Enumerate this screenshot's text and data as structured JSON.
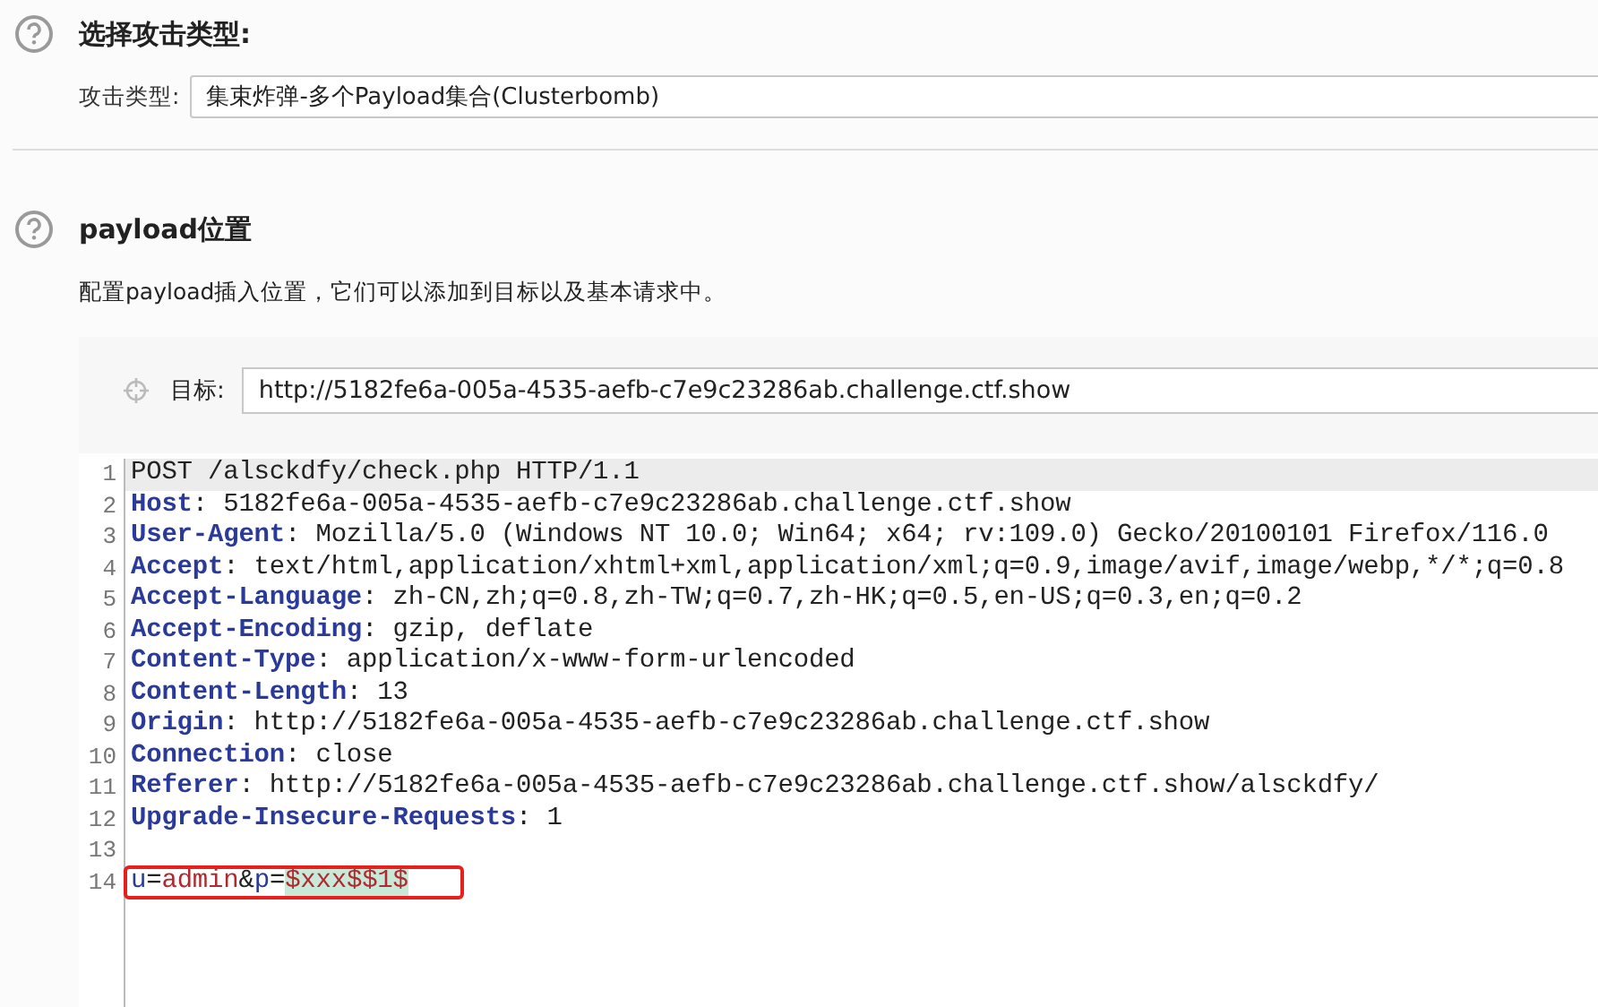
{
  "attack_section": {
    "title": "选择攻击类型:",
    "field_label": "攻击类型:",
    "attack_type": "集束炸弹-多个Payload集合(Clusterbomb)"
  },
  "payload_section": {
    "title": "payload位置",
    "description": "配置payload插入位置，它们可以添加到目标以及基本请求中。",
    "target": {
      "label": "目标:",
      "value": "http://5182fe6a-005a-4535-aefb-c7e9c23286ab.challenge.ctf.show"
    },
    "request_lines": [
      {
        "number": "1",
        "highlighted": true,
        "outlined": false,
        "segments": [
          {
            "kind": "text",
            "text": "POST /alsckdfy/check.php HTTP/1.1"
          }
        ]
      },
      {
        "number": "2",
        "highlighted": false,
        "outlined": false,
        "segments": [
          {
            "kind": "header_name",
            "text": "Host"
          },
          {
            "kind": "text",
            "text": ": 5182fe6a-005a-4535-aefb-c7e9c23286ab.challenge.ctf.show"
          }
        ]
      },
      {
        "number": "3",
        "highlighted": false,
        "outlined": false,
        "segments": [
          {
            "kind": "header_name",
            "text": "User-Agent"
          },
          {
            "kind": "text",
            "text": ": Mozilla/5.0 (Windows NT 10.0; Win64; x64; rv:109.0) Gecko/20100101 Firefox/116.0"
          }
        ]
      },
      {
        "number": "4",
        "highlighted": false,
        "outlined": false,
        "segments": [
          {
            "kind": "header_name",
            "text": "Accept"
          },
          {
            "kind": "text",
            "text": ": text/html,application/xhtml+xml,application/xml;q=0.9,image/avif,image/webp,*/*;q=0.8"
          }
        ]
      },
      {
        "number": "5",
        "highlighted": false,
        "outlined": false,
        "segments": [
          {
            "kind": "header_name",
            "text": "Accept-Language"
          },
          {
            "kind": "text",
            "text": ": zh-CN,zh;q=0.8,zh-TW;q=0.7,zh-HK;q=0.5,en-US;q=0.3,en;q=0.2"
          }
        ]
      },
      {
        "number": "6",
        "highlighted": false,
        "outlined": false,
        "segments": [
          {
            "kind": "header_name",
            "text": "Accept-Encoding"
          },
          {
            "kind": "text",
            "text": ": gzip, deflate"
          }
        ]
      },
      {
        "number": "7",
        "highlighted": false,
        "outlined": false,
        "segments": [
          {
            "kind": "header_name",
            "text": "Content-Type"
          },
          {
            "kind": "text",
            "text": ": application/x-www-form-urlencoded"
          }
        ]
      },
      {
        "number": "8",
        "highlighted": false,
        "outlined": false,
        "segments": [
          {
            "kind": "header_name",
            "text": "Content-Length"
          },
          {
            "kind": "text",
            "text": ": 13"
          }
        ]
      },
      {
        "number": "9",
        "highlighted": false,
        "outlined": false,
        "segments": [
          {
            "kind": "header_name",
            "text": "Origin"
          },
          {
            "kind": "text",
            "text": ": http://5182fe6a-005a-4535-aefb-c7e9c23286ab.challenge.ctf.show"
          }
        ]
      },
      {
        "number": "10",
        "highlighted": false,
        "outlined": false,
        "segments": [
          {
            "kind": "header_name",
            "text": "Connection"
          },
          {
            "kind": "text",
            "text": ": close"
          }
        ]
      },
      {
        "number": "11",
        "highlighted": false,
        "outlined": false,
        "segments": [
          {
            "kind": "header_name",
            "text": "Referer"
          },
          {
            "kind": "text",
            "text": ": http://5182fe6a-005a-4535-aefb-c7e9c23286ab.challenge.ctf.show/alsckdfy/"
          }
        ]
      },
      {
        "number": "12",
        "highlighted": false,
        "outlined": false,
        "segments": [
          {
            "kind": "header_name",
            "text": "Upgrade-Insecure-Requests"
          },
          {
            "kind": "text",
            "text": ": 1"
          }
        ]
      },
      {
        "number": "13",
        "highlighted": false,
        "outlined": false
      },
      {
        "number": "14",
        "highlighted": false,
        "outlined": true,
        "segments": [
          {
            "kind": "param_name",
            "text": "u"
          },
          {
            "kind": "text",
            "text": "="
          },
          {
            "kind": "param_value",
            "text": "admin"
          },
          {
            "kind": "text",
            "text": "&"
          },
          {
            "kind": "param_name",
            "text": "p"
          },
          {
            "kind": "text",
            "text": "="
          },
          {
            "kind": "payload",
            "text": "$xxx$$1$"
          }
        ]
      }
    ]
  }
}
